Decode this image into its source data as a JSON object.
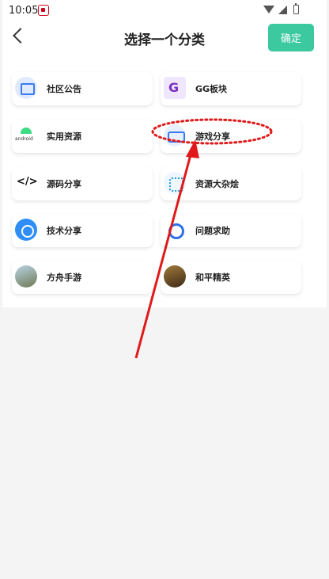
{
  "status_bar": {
    "time": "10:05"
  },
  "header": {
    "title": "选择一个分类",
    "confirm_label": "确定"
  },
  "categories": [
    {
      "label": "社区公告",
      "icon": "announcement-icon"
    },
    {
      "label": "GG板块",
      "icon": "gg-icon"
    },
    {
      "label": "实用资源",
      "icon": "android-icon"
    },
    {
      "label": "游戏分享",
      "icon": "gamepad-icon"
    },
    {
      "label": "源码分享",
      "icon": "code-icon"
    },
    {
      "label": "资源大杂烩",
      "icon": "resources-icon"
    },
    {
      "label": "技术分享",
      "icon": "share-icon"
    },
    {
      "label": "问题求助",
      "icon": "help-icon"
    },
    {
      "label": "方舟手游",
      "icon": "ark-game-icon"
    },
    {
      "label": "和平精英",
      "icon": "peace-elite-icon"
    }
  ],
  "annotation": {
    "highlighted_category": "游戏分享",
    "color": "#e01a1a"
  }
}
